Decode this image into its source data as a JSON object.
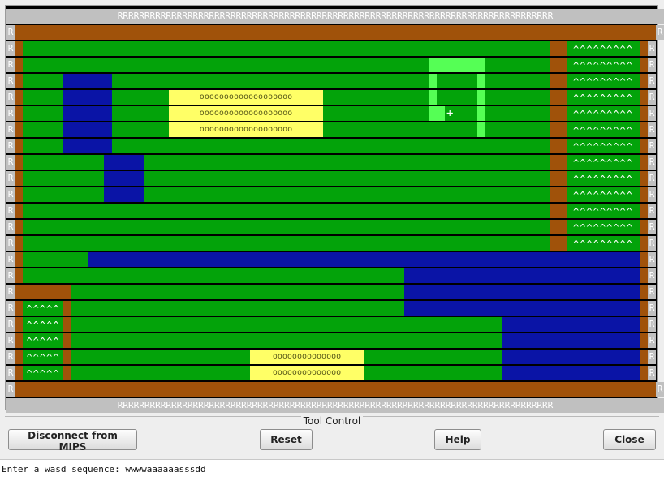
{
  "board": {
    "colors": {
      "wall_gray": "#c0c0c0",
      "dirt_brown": "#a0520a",
      "grass_green": "#03a30a",
      "water_blue": "#0a14a6",
      "coin_yellow": "#ffff66",
      "highlight_green": "#55ff55",
      "grid_line": "#000000"
    },
    "wall_char": "R",
    "coin_char": "o",
    "spike_char": "^",
    "player_marker": "+",
    "rows": [
      "RRRRRRRRRRRRRRRRRRRRRRRRRRRRRRRRRRRRRRRRRRRRRRRRRRRRRRRRRRRRRRRRRRRRRRRRRRRRRRRRR",
      "RBBBBBBBBBBBBBBBBBBBBBBBBBBBBBBBBBBBBBBBBBBBBBBBBBBBBBBBBBBBBBBBBBBBBBBBBBBBBBBBR",
      "RBGGGGGGGGGGGGGGGGGGGGGGGGGGGGGGGGGGGGGGGGGGGGGGGGGGGGGGGGGGGGGGGGGBBSSSSSSSSSBR",
      "RBGGGGGGGGGGGGGGGGGGGGGGGGGGGGGGGGGGGGGGGGGGGGGGGGGGLLLLLLLGGGGGGGGBBSSSSSSSSSBR",
      "RBGGGGGWWWWWWGGGGGGGGGGGGGGGGGGGGGGGGGGGGGGGGGGGGGGGLGGGGGLGGGGGGGGBBSSSSSSSSSBR",
      "RBGGGGGWWWWWWGGGGGGGYYYYYYYYYYYYYYYYYYYGGGGGGGGGGGGGLGGGGGLGGGGGGGGBBSSSSSSSSSBR",
      "RBGGGGGWWWWWWGGGGGGGYYYYYYYYYYYYYYYYYYYGGGGGGGGGGGGGLLGGGGLGGGGGGGGBBSSSSSSSSSBR",
      "RBGGGGGWWWWWWGGGGGGGYYYYYYYYYYYYYYYYYYYGGGGGGGGGGGGGGGGGGGLGGGGGGGGBBSSSSSSSSSBR",
      "RBGGGGGWWWWWWGGGGGGGGGGGGGGGGGGGGGGGGGGGGGGGGGGGGGGGGGGGGGGGGGGGGGGBBSSSSSSSSSBR",
      "RBGGGGGGGGGGWWWWWGGGGGGGGGGGGGGGGGGGGGGGGGGGGGGGGGGGGGGGGGGGGGGGGGGBBSSSSSSSSSBR",
      "RBGGGGGGGGGGWWWWWGGGGGGGGGGGGGGGGGGGGGGGGGGGGGGGGGGGGGGGGGGGGGGGGGGBBSSSSSSSSSBR",
      "RBGGGGGGGGGGWWWWWGGGGGGGGGGGGGGGGGGGGGGGGGGGGGGGGGGGGGGGGGGGGGGGGGGBBSSSSSSSSSBR",
      "RBGGGGGGGGGGGGGGGGGGGGGGGGGGGGGGGGGGGGGGGGGGGGGGGGGGGGGGGGGGGGGGGGGBBSSSSSSSSSBR",
      "RBGGGGGGGGGGGGGGGGGGGGGGGGGGGGGGGGGGGGGGGGGGGGGGGGGGGGGGGGGGGGGGGGGBBSSSSSSSSSBR",
      "RBGGGGGGGGGGGGGGGGGGGGGGGGGGGGGGGGGGGGGGGGGGGGGGGGGGGGGGGGGGGGGGGGGBBSSSSSSSSSBR",
      "RBGGGGGGGGWWWWWWWWWWWWWWWWWWWWWWWWWWWWWWWWWWWWWWWWWWWWWWWWWWWWWWWWWWWWWWWWWWWWBR",
      "RBGGGGGGGGGGGGGGGGGGGGGGGGGGGGGGGGGGGGGGGGGGGGGGGWWWWWWWWWWWWWWWWWWWWWWWWWWWWWBR",
      "RBBBBBBBGGGGGGGGGGGGGGGGGGGGGGGGGGGGGGGGGGGGGGGGGWWWWWWWWWWWWWWWWWWWWWWWWWWWWWBR",
      "RBSSSSSBGGGGGGGGGGGGGGGGGGGGGGGGGGGGGGGGGGGGGGGGGWWWWWWWWWWWWWWWWWWWWWWWWWWWWWBR",
      "RBSSSSSBGGGGGGGGGGGGGGGGGGGGGGGGGGGGGGGGGGGGGGGGGGGGGGGGGGGGGWWWWWWWWWWWWWWWWWBR",
      "RBSSSSSBGGGGGGGGGGGGGGGGGGGGGGGGGGGGGGGGGGGGGGGGGGGGGGGGGGGGGWWWWWWWWWWWWWWWWWBR",
      "RBSSSSSBGGGGGGGGGGGGGGGGGGGGGGYYYYYYYYYYYYYYGGGGGGGGGGGGGGGGGWWWWWWWWWWWWWWWWWBR",
      "RBSSSSSBGGGGGGGGGGGGGGGGGGGGGGYYYYYYYYYYYYYYGGGGGGGGGGGGGGGGGWWWWWWWWWWWWWWWWWBR",
      "RBBBBBBBBBBBBBBBBBBBBBBBBBBBBBBBBBBBBBBBBBBBBBBBBBBBBBBBBBBBBBBBBBBBBBBBBBBBBBBBR",
      "RRRRRRRRRRRRRRRRRRRRRRRRRRRRRRRRRRRRRRRRRRRRRRRRRRRRRRRRRRRRRRRRRRRRRRRRRRRRRRRRR"
    ]
  },
  "tool_control": {
    "title": "Tool Control",
    "disconnect_label": "Disconnect from MIPS",
    "reset_label": "Reset",
    "help_label": "Help",
    "close_label": "Close"
  },
  "console": {
    "prompt_text": "Enter a wasd sequence: wwwwaaaaaasssdd"
  }
}
